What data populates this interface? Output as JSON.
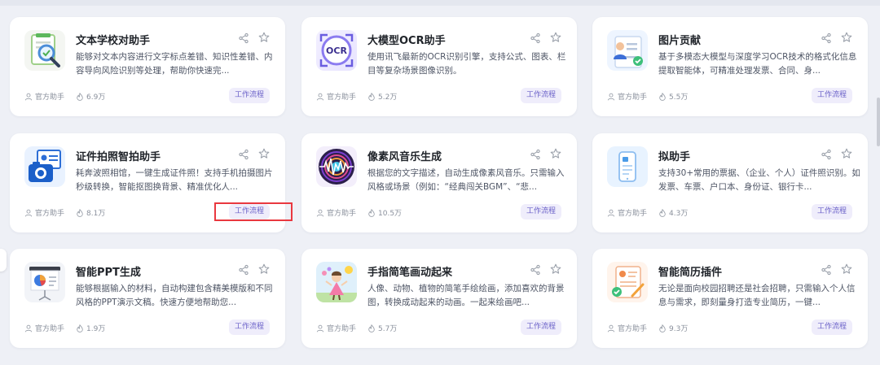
{
  "cards": [
    {
      "title": "文本学校对助手",
      "desc": "能够对文本内容进行文字标点差错、知识性差错、内容导向风险识别等处理，帮助你快速完...",
      "author": "官方助手",
      "count": "6.9万",
      "tag": "工作流程",
      "icon": "proofread-magnifier-icon"
    },
    {
      "title": "大模型OCR助手",
      "desc": "使用讯飞最新的OCR识别引擎，支持公式、图表、栏目等复杂场景图像识别。",
      "author": "官方助手",
      "count": "5.2万",
      "tag": "工作流程",
      "icon": "ocr-icon"
    },
    {
      "title": "图片贡献",
      "desc": "基于多模态大模型与深度学习OCR技术的格式化信息提取智能体，可精准处理发票、合同、身...",
      "author": "官方助手",
      "count": "5.5万",
      "tag": "工作流程",
      "icon": "id-document-icon"
    },
    {
      "title": "证件拍照智拍助手",
      "desc": "耗奔波照相馆，一键生成证件照！支持手机拍摄图片秒级转换，智能抠图换背景、精准优化人...",
      "author": "官方助手",
      "count": "8.1万",
      "tag": "工作流程",
      "icon": "camera-id-icon"
    },
    {
      "title": "像素风音乐生成",
      "desc": "根据您的文字描述，自动生成像素风音乐。只需输入风格或场景（例如：“经典闯关BGM”、“悲...",
      "author": "官方助手",
      "count": "10.5万",
      "tag": "工作流程",
      "icon": "vinyl-music-icon"
    },
    {
      "title": "拟助手",
      "desc": "支持30+常用的票据、（企业、个人）证件照识别。如发票、车票、户口本、身份证、银行卡...",
      "author": "官方助手",
      "count": "4.3万",
      "tag": "工作流程",
      "icon": "phone-document-icon"
    },
    {
      "title": "智能PPT生成",
      "desc": "能够根据输入的材料，自动构建包含精美模版和不同风格的PPT演示文稿。快速方便地帮助您...",
      "author": "官方助手",
      "count": "1.9万",
      "tag": "工作流程",
      "icon": "presentation-chart-icon"
    },
    {
      "title": "手指简笔画动起来",
      "desc": "人像、动物、植物的简笔手绘绘画，添加喜欢的背景图，转换成动起来的动画。一起来绘画吧...",
      "author": "官方助手",
      "count": "5.7万",
      "tag": "工作流程",
      "icon": "kid-drawing-icon"
    },
    {
      "title": "智能简历插件",
      "desc": "无论是面向校园招聘还是社会招聘，只需输入个人信息与需求，即刻量身打造专业简历，一键...",
      "author": "官方助手",
      "count": "9.3万",
      "tag": "工作流程",
      "icon": "resume-check-icon"
    }
  ],
  "colors": {
    "accent": "#6a60c8",
    "tag_bg": "#efedfb",
    "highlight": "#e9383f",
    "page_bg": "#eef0f6"
  }
}
